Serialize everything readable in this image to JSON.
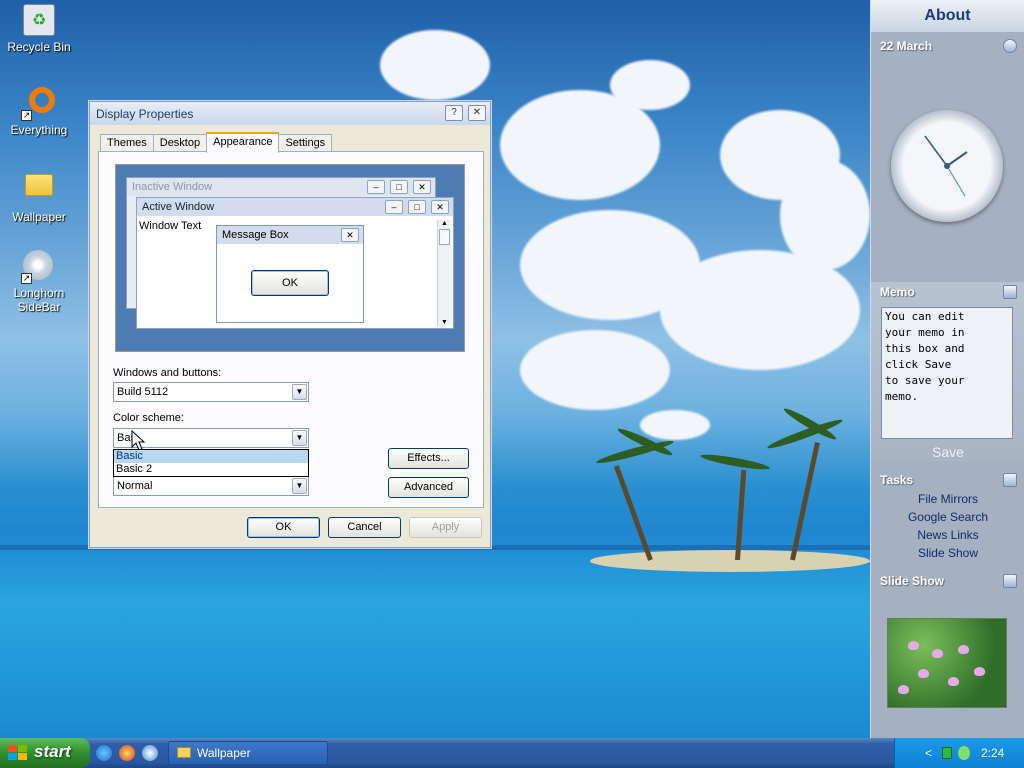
{
  "desktop": {
    "icons": [
      {
        "label": "Recycle Bin",
        "icon": "recycle-bin-icon"
      },
      {
        "label": "Everything",
        "icon": "everything-icon"
      },
      {
        "label": "Wallpaper",
        "icon": "folder-icon"
      },
      {
        "label_line1": "Longhorn",
        "label_line2": "SideBar",
        "icon": "cd-icon"
      }
    ]
  },
  "dialog": {
    "title": "Display Properties",
    "help_btn": "?",
    "close_btn": "✕",
    "tabs": [
      "Themes",
      "Desktop",
      "Appearance",
      "Settings"
    ],
    "active_tab": "Appearance",
    "preview": {
      "inactive_title": "Inactive Window",
      "active_title": "Active Window",
      "window_text": "Window Text",
      "msgbox_title": "Message Box",
      "msgbox_ok": "OK"
    },
    "windows_buttons_label": "Windows and buttons:",
    "windows_buttons_value": "Build 5112",
    "color_scheme_label": "Color scheme:",
    "color_scheme_value": "Bas",
    "color_scheme_options": [
      "Basic",
      "Basic 2"
    ],
    "font_size_value": "Normal",
    "effects_btn": "Effects...",
    "advanced_btn": "Advanced",
    "ok_btn": "OK",
    "cancel_btn": "Cancel",
    "apply_btn": "Apply"
  },
  "sidebar": {
    "about_title": "About",
    "date": "22 March",
    "memo_title": "Memo",
    "memo_text": "You can edit\nyour memo in\nthis box and\nclick Save\nto save your\nmemo.",
    "memo_save": "Save",
    "tasks_title": "Tasks",
    "tasks": [
      "File Mirrors",
      "Google Search",
      "News Links",
      "Slide Show"
    ],
    "slideshow_title": "Slide Show"
  },
  "taskbar": {
    "start_label": "start",
    "task_item": "Wallpaper",
    "clock": "2:24 PM",
    "tray_arrow": "<"
  },
  "colors": {
    "accent": "#2b58a0",
    "start_green": "#2f8e2e",
    "tab_highlight": "#f0a41a"
  }
}
